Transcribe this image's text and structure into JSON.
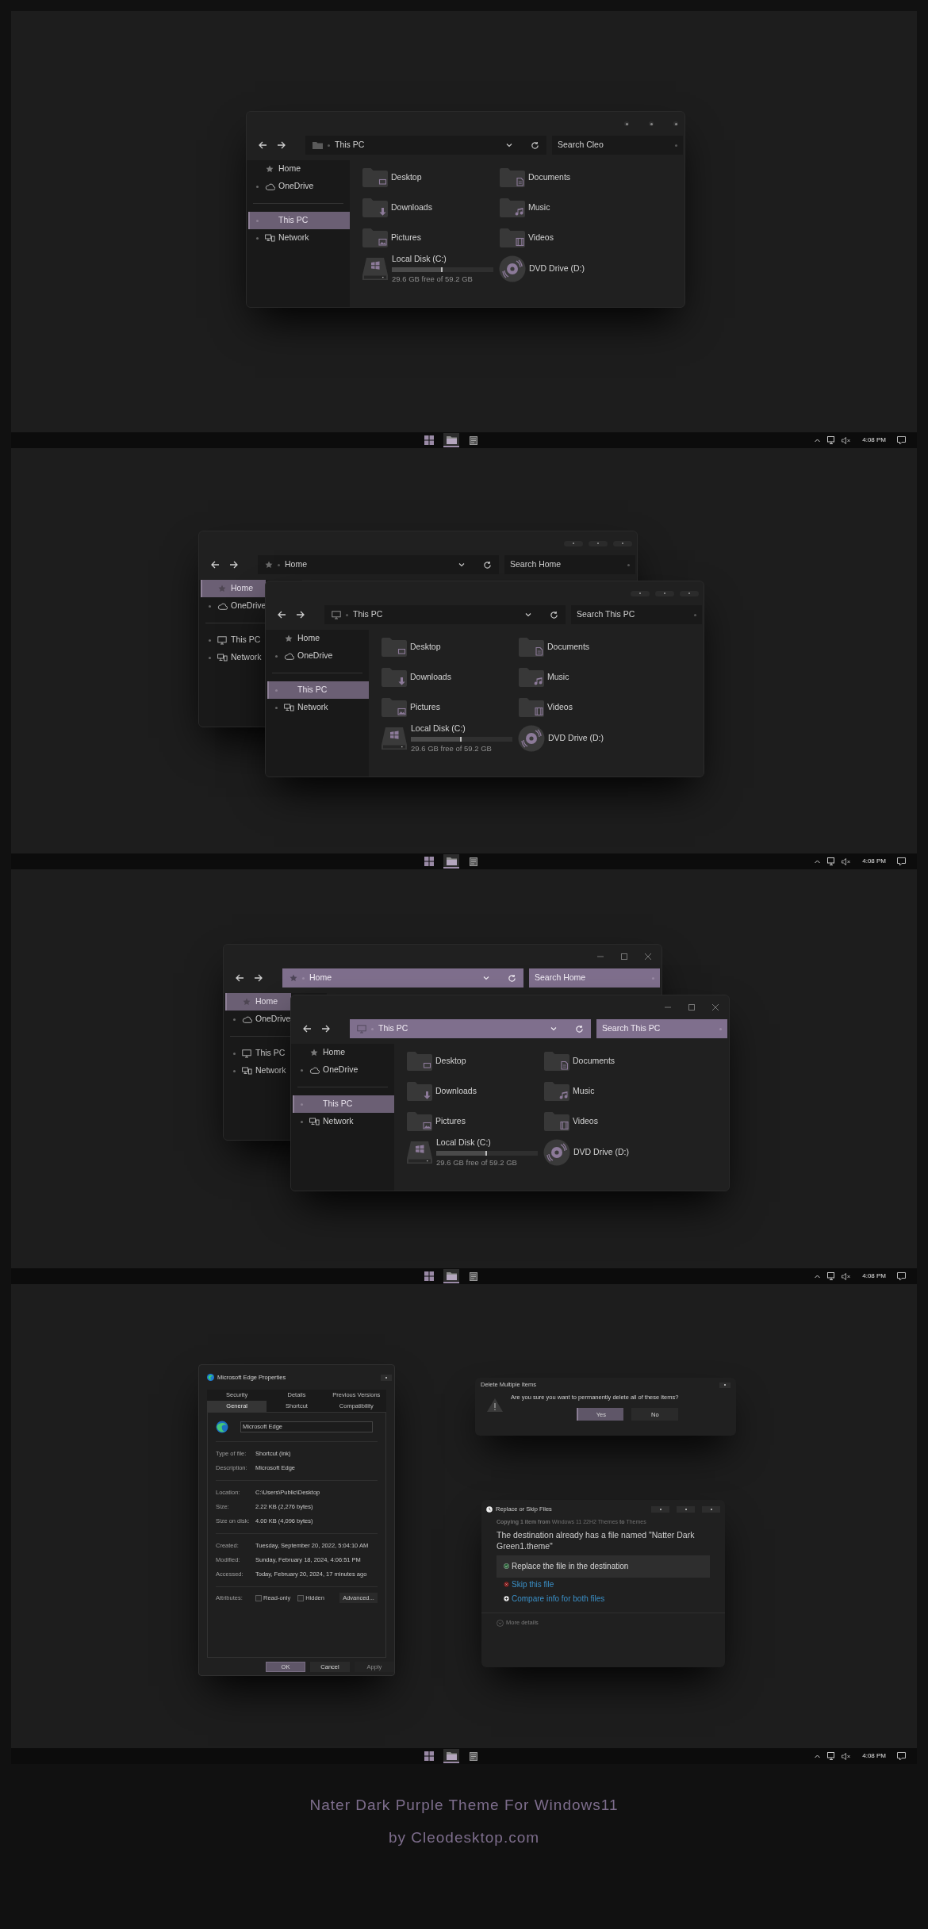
{
  "desktops": [
    {
      "windows": [
        {
          "kind": "explorer",
          "window_controls": [
            {
              "kind": "dot"
            },
            {
              "kind": "dot"
            },
            {
              "kind": "dot"
            }
          ],
          "accent_toolbar": false,
          "address": {
            "kind": "folder",
            "text": "This PC"
          },
          "search_placeholder": "Search Cleo",
          "nav": [
            {
              "items": [
                {
                  "label": "Home",
                  "kind": "home",
                  "expandable": false,
                  "selected": false
                },
                {
                  "label": "OneDrive",
                  "kind": "cloud",
                  "expandable": true,
                  "selected": false
                }
              ]
            },
            {
              "items": [
                {
                  "label": "This PC",
                  "kind": "pc",
                  "expandable": true,
                  "selected": true
                },
                {
                  "label": "Network",
                  "kind": "network",
                  "expandable": true,
                  "selected": false
                }
              ]
            }
          ],
          "folders": [
            {
              "label": "Desktop",
              "kind": "desktop"
            },
            {
              "label": "Documents",
              "kind": "documents"
            },
            {
              "label": "Downloads",
              "kind": "downloads"
            },
            {
              "label": "Music",
              "kind": "music"
            },
            {
              "label": "Pictures",
              "kind": "pictures"
            },
            {
              "label": "Videos",
              "kind": "videos"
            }
          ],
          "drives": [
            {
              "kind": "disk",
              "label": "Local Disk (C:)",
              "level": 0.5,
              "detail": "29.6 GB free of 59.2 GB"
            },
            {
              "kind": "dvd",
              "label": "DVD Drive (D:)"
            }
          ]
        }
      ],
      "taskbar": {
        "apps": [
          {
            "kind": "start",
            "active": false
          },
          {
            "kind": "explorer",
            "active": true
          },
          {
            "kind": "notes",
            "active": false
          }
        ],
        "time": "4:08 PM"
      }
    },
    {
      "windows": [
        {
          "kind": "explorer",
          "window_controls": [
            {
              "kind": "pill"
            },
            {
              "kind": "pill"
            },
            {
              "kind": "pill"
            }
          ],
          "accent_toolbar": false,
          "address": {
            "kind": "home",
            "text": "Home"
          },
          "search_placeholder": "Search Home",
          "nav": [
            {
              "items": [
                {
                  "label": "Home",
                  "kind": "home",
                  "expandable": false,
                  "selected": true
                },
                {
                  "label": "OneDrive",
                  "kind": "cloud",
                  "expandable": true,
                  "selected": false
                }
              ]
            },
            {
              "items": [
                {
                  "label": "This PC",
                  "kind": "pc",
                  "expandable": true,
                  "selected": false
                },
                {
                  "label": "Network",
                  "kind": "network",
                  "expandable": true,
                  "selected": false
                }
              ]
            }
          ]
        },
        {
          "kind": "explorer",
          "window_controls": [
            {
              "kind": "pill"
            },
            {
              "kind": "pill"
            },
            {
              "kind": "pill"
            }
          ],
          "accent_toolbar": false,
          "address": {
            "kind": "pc",
            "text": "This PC"
          },
          "search_placeholder": "Search This PC",
          "nav": [
            {
              "items": [
                {
                  "label": "Home",
                  "kind": "home",
                  "expandable": false,
                  "selected": false
                },
                {
                  "label": "OneDrive",
                  "kind": "cloud",
                  "expandable": true,
                  "selected": false
                }
              ]
            },
            {
              "items": [
                {
                  "label": "This PC",
                  "kind": "pc",
                  "expandable": true,
                  "selected": true
                },
                {
                  "label": "Network",
                  "kind": "network",
                  "expandable": true,
                  "selected": false
                }
              ]
            }
          ],
          "folders": [
            {
              "label": "Desktop",
              "kind": "desktop"
            },
            {
              "label": "Documents",
              "kind": "documents"
            },
            {
              "label": "Downloads",
              "kind": "downloads"
            },
            {
              "label": "Music",
              "kind": "music"
            },
            {
              "label": "Pictures",
              "kind": "pictures"
            },
            {
              "label": "Videos",
              "kind": "videos"
            }
          ],
          "drives": [
            {
              "kind": "disk",
              "label": "Local Disk (C:)",
              "level": 0.5,
              "detail": "29.6 GB free of 59.2 GB"
            },
            {
              "kind": "dvd",
              "label": "DVD Drive (D:)"
            }
          ]
        }
      ],
      "taskbar": {
        "apps": [
          {
            "kind": "start",
            "active": false
          },
          {
            "kind": "explorer",
            "active": true
          },
          {
            "kind": "notes",
            "active": false
          }
        ],
        "time": "4:08 PM"
      }
    },
    {
      "windows": [
        {
          "kind": "explorer",
          "window_controls": [
            {
              "kind": "minimize"
            },
            {
              "kind": "maximize"
            },
            {
              "kind": "close"
            }
          ],
          "accent_toolbar": true,
          "address": {
            "kind": "home",
            "text": "Home"
          },
          "search_placeholder": "Search Home",
          "nav": [
            {
              "items": [
                {
                  "label": "Home",
                  "kind": "home",
                  "expandable": false,
                  "selected": true
                },
                {
                  "label": "OneDrive",
                  "kind": "cloud",
                  "expandable": true,
                  "selected": false
                }
              ]
            },
            {
              "items": [
                {
                  "label": "This PC",
                  "kind": "pc",
                  "expandable": true,
                  "selected": false
                },
                {
                  "label": "Network",
                  "kind": "network",
                  "expandable": true,
                  "selected": false
                }
              ]
            }
          ]
        },
        {
          "kind": "explorer",
          "window_controls": [
            {
              "kind": "minimize"
            },
            {
              "kind": "maximize"
            },
            {
              "kind": "close"
            }
          ],
          "accent_toolbar": true,
          "address": {
            "kind": "pc",
            "text": "This PC"
          },
          "search_placeholder": "Search This PC",
          "nav": [
            {
              "items": [
                {
                  "label": "Home",
                  "kind": "home",
                  "expandable": false,
                  "selected": false
                },
                {
                  "label": "OneDrive",
                  "kind": "cloud",
                  "expandable": true,
                  "selected": false
                }
              ]
            },
            {
              "items": [
                {
                  "label": "This PC",
                  "kind": "pc",
                  "expandable": true,
                  "selected": true
                },
                {
                  "label": "Network",
                  "kind": "network",
                  "expandable": true,
                  "selected": false
                }
              ]
            }
          ],
          "folders": [
            {
              "label": "Desktop",
              "kind": "desktop"
            },
            {
              "label": "Documents",
              "kind": "documents"
            },
            {
              "label": "Downloads",
              "kind": "downloads"
            },
            {
              "label": "Music",
              "kind": "music"
            },
            {
              "label": "Pictures",
              "kind": "pictures"
            },
            {
              "label": "Videos",
              "kind": "videos"
            }
          ],
          "drives": [
            {
              "kind": "disk",
              "label": "Local Disk (C:)",
              "level": 0.5,
              "detail": "29.6 GB free of 59.2 GB"
            },
            {
              "kind": "dvd",
              "label": "DVD Drive (D:)"
            }
          ]
        }
      ],
      "taskbar": {
        "apps": [
          {
            "kind": "start",
            "active": false
          },
          {
            "kind": "explorer",
            "active": true
          },
          {
            "kind": "notes",
            "active": false
          }
        ],
        "time": "4:08 PM"
      }
    },
    {
      "windows": [
        {
          "kind": "properties",
          "title": "Microsoft Edge Properties",
          "tab_rows": [
            [
              {
                "label": "Security",
                "selected": false
              },
              {
                "label": "Details",
                "selected": false
              },
              {
                "label": "Previous Versions",
                "selected": false
              }
            ],
            [
              {
                "label": "General",
                "selected": true
              },
              {
                "label": "Shortcut",
                "selected": false
              },
              {
                "label": "Compatibility",
                "selected": false
              }
            ]
          ],
          "name_value": "Microsoft Edge",
          "groups": [
            [
              {
                "label": "Type of file:",
                "value": "Shortcut (lnk)"
              },
              {
                "label": "Description:",
                "value": "Microsoft Edge"
              }
            ],
            [
              {
                "label": "Location:",
                "value": "C:\\Users\\Public\\Desktop"
              },
              {
                "label": "Size:",
                "value": "2.22 KB (2,276 bytes)"
              },
              {
                "label": "Size on disk:",
                "value": "4.00 KB (4,096 bytes)"
              }
            ],
            [
              {
                "label": "Created:",
                "value": "Tuesday, September 20, 2022, 5:04:10 AM"
              },
              {
                "label": "Modified:",
                "value": "Sunday, February 18, 2024, 4:06:51 PM"
              },
              {
                "label": "Accessed:",
                "value": "Today, February 20, 2024, 17 minutes ago"
              }
            ]
          ],
          "attributes_label": "Attributes:",
          "attributes": [
            {
              "label": "Read-only",
              "checked": false
            },
            {
              "label": "Hidden",
              "checked": false
            }
          ],
          "advanced_button": "Advanced...",
          "buttons": [
            {
              "label": "OK",
              "primary": true,
              "disabled": false
            },
            {
              "label": "Cancel",
              "primary": false,
              "disabled": false
            },
            {
              "label": "Apply",
              "primary": false,
              "disabled": true
            }
          ]
        },
        {
          "kind": "confirm",
          "title": "Delete Multiple Items",
          "message": "Are you sure you want to permanently delete all of these items?",
          "buttons": [
            {
              "label": "Yes",
              "primary": true
            },
            {
              "label": "No",
              "primary": false
            }
          ]
        },
        {
          "kind": "conflict",
          "title": "Replace or Skip Files",
          "copy_line": "**Copying 1 item from** Windows 11 22H2 Themes **to** Themes",
          "heading": "The destination already has a file named \"Natter Dark Green1.theme\"",
          "options": [
            {
              "kind": "replace",
              "label": "Replace the file in the destination",
              "selected": true
            },
            {
              "kind": "skip",
              "label": "Skip this file",
              "selected": false
            },
            {
              "kind": "compare",
              "label": "Compare info for both files",
              "selected": false
            }
          ],
          "more": "More details"
        }
      ],
      "taskbar": {
        "apps": [
          {
            "kind": "start",
            "active": false
          },
          {
            "kind": "explorer",
            "active": true
          },
          {
            "kind": "notes",
            "active": false
          }
        ],
        "time": "4:08 PM"
      }
    }
  ],
  "caption": {
    "title": "Nater Dark Purple Theme For Windows11",
    "credit": "by Cleodesktop.com"
  }
}
